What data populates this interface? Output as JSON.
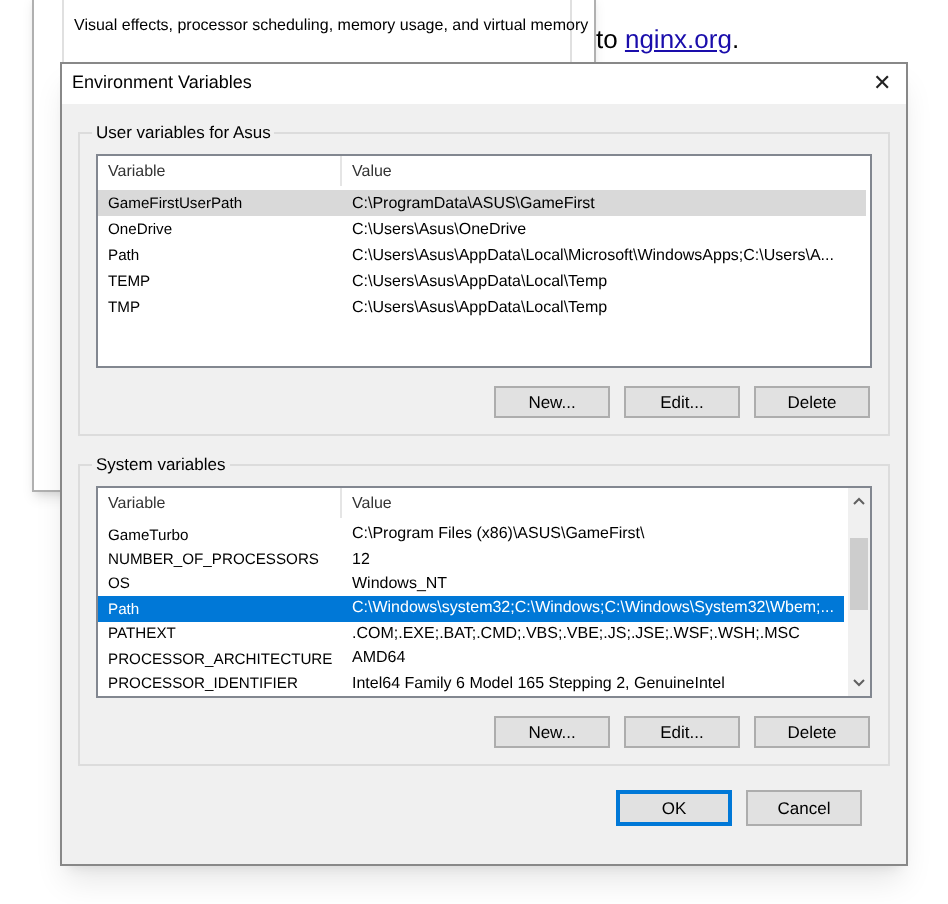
{
  "background_window": {
    "description": "Visual effects, processor scheduling, memory usage, and virtual memory"
  },
  "page_text": {
    "before": "to ",
    "link": "nginx.org",
    "after": "."
  },
  "dialog": {
    "title": "Environment Variables",
    "close": "✕"
  },
  "user_variables": {
    "label": "User variables for Asus",
    "focused": false,
    "columns": [
      "Variable",
      "Value"
    ],
    "rows": [
      {
        "variable": "GameFirstUserPath",
        "value": "C:\\ProgramData\\ASUS\\GameFirst",
        "selected": true
      },
      {
        "variable": "OneDrive",
        "value": "C:\\Users\\Asus\\OneDrive",
        "selected": false
      },
      {
        "variable": "Path",
        "value": "C:\\Users\\Asus\\AppData\\Local\\Microsoft\\WindowsApps;C:\\Users\\A...",
        "selected": false
      },
      {
        "variable": "TEMP",
        "value": "C:\\Users\\Asus\\AppData\\Local\\Temp",
        "selected": false
      },
      {
        "variable": "TMP",
        "value": "C:\\Users\\Asus\\AppData\\Local\\Temp",
        "selected": false
      }
    ],
    "buttons": [
      "New...",
      "Edit...",
      "Delete"
    ]
  },
  "system_variables": {
    "label": "System variables",
    "focused": true,
    "columns": [
      "Variable",
      "Value"
    ],
    "rows": [
      {
        "variable": "GameTurbo",
        "value": "C:\\Program Files (x86)\\ASUS\\GameFirst\\",
        "selected": false
      },
      {
        "variable": "NUMBER_OF_PROCESSORS",
        "value": "12",
        "selected": false
      },
      {
        "variable": "OS",
        "value": "Windows_NT",
        "selected": false
      },
      {
        "variable": "Path",
        "value": "C:\\Windows\\system32;C:\\Windows;C:\\Windows\\System32\\Wbem;...",
        "selected": true
      },
      {
        "variable": "PATHEXT",
        "value": ".COM;.EXE;.BAT;.CMD;.VBS;.VBE;.JS;.JSE;.WSF;.WSH;.MSC",
        "selected": false
      },
      {
        "variable": "PROCESSOR_ARCHITECTURE",
        "value": "AMD64",
        "selected": false
      },
      {
        "variable": "PROCESSOR_IDENTIFIER",
        "value": "Intel64 Family 6 Model 165 Stepping 2, GenuineIntel",
        "selected": false
      }
    ],
    "buttons": [
      "New...",
      "Edit...",
      "Delete"
    ]
  },
  "footer_buttons": [
    {
      "label": "OK",
      "default": true
    },
    {
      "label": "Cancel",
      "default": false
    }
  ]
}
